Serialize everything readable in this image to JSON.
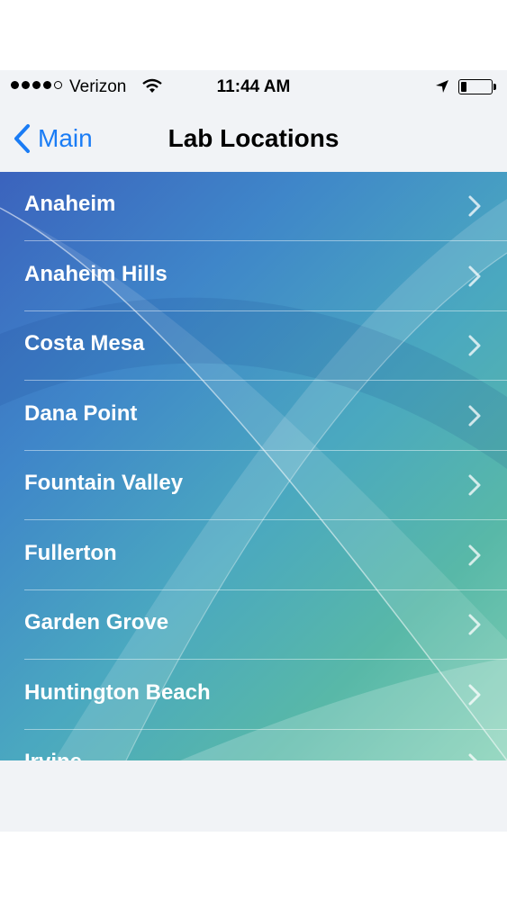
{
  "status_bar": {
    "carrier": "Verizon",
    "time": "11:44 AM",
    "signal_bars_filled": 4,
    "signal_bars_total": 5,
    "battery_level": 0.2
  },
  "nav": {
    "back_label": "Main",
    "title": "Lab Locations"
  },
  "colors": {
    "accent": "#1a7cf5"
  },
  "locations": [
    "Anaheim",
    "Anaheim Hills",
    "Costa Mesa",
    "Dana Point",
    "Fountain Valley",
    "Fullerton",
    "Garden Grove",
    "Huntington Beach",
    "Irvine"
  ]
}
